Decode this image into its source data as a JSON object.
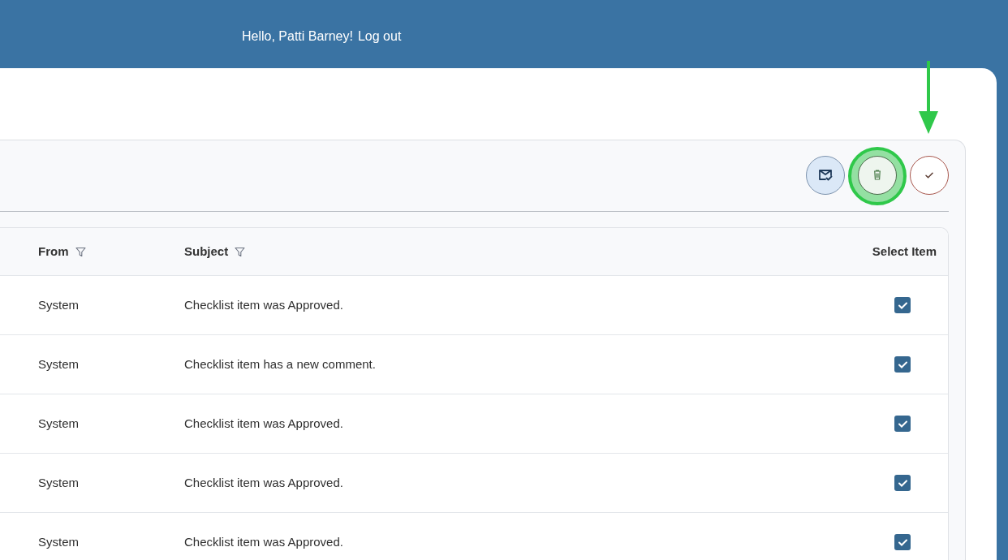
{
  "header": {
    "greeting": "Hello, Patti Barney!",
    "logout": "Log out"
  },
  "toolbar": {
    "buttons": [
      {
        "kind": "mail-check",
        "circled": false,
        "arrow": false
      },
      {
        "kind": "delete",
        "circled": true,
        "arrow": false
      },
      {
        "kind": "check",
        "circled": false,
        "arrow": true
      }
    ]
  },
  "table": {
    "columns": [
      {
        "label": "From",
        "filter": true
      },
      {
        "label": "Subject",
        "filter": true
      },
      {
        "label": "Select Item",
        "filter": false
      }
    ],
    "rows": [
      {
        "from": "System",
        "subject": "Checklist item was Approved.",
        "checked": true
      },
      {
        "from": "System",
        "subject": "Checklist item has a new comment.",
        "checked": true
      },
      {
        "from": "System",
        "subject": "Checklist item was Approved.",
        "checked": true
      },
      {
        "from": "System",
        "subject": "Checklist item was Approved.",
        "checked": true
      },
      {
        "from": "System",
        "subject": "Checklist item was Approved.",
        "checked": true
      }
    ]
  }
}
